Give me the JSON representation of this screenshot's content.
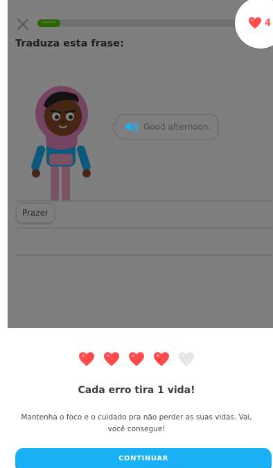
{
  "lesson": {
    "prompt_title": "Traduza esta frase:",
    "progress_fraction": 0.11,
    "bubble_text": "Good afternoon.",
    "word_bank": [
      "Prazer"
    ],
    "hearts_count": "4"
  },
  "sheet": {
    "hearts_filled": 4,
    "hearts_total": 5,
    "title": "Cada erro tira 1 vida!",
    "body": "Mantenha o foco e o cuidado pra não perder as suas vidas. Vai, você consegue!",
    "continue_label": "CONTINUAR"
  },
  "colors": {
    "heart": "#ff4b4b",
    "heart_empty": "#e5e5e5",
    "progress": "#58cc02",
    "button": "#1cb0f6",
    "speaker": "#1cb0f6"
  },
  "icons": {
    "close": "close-icon",
    "speaker": "speaker-icon",
    "heart": "heart-icon"
  }
}
